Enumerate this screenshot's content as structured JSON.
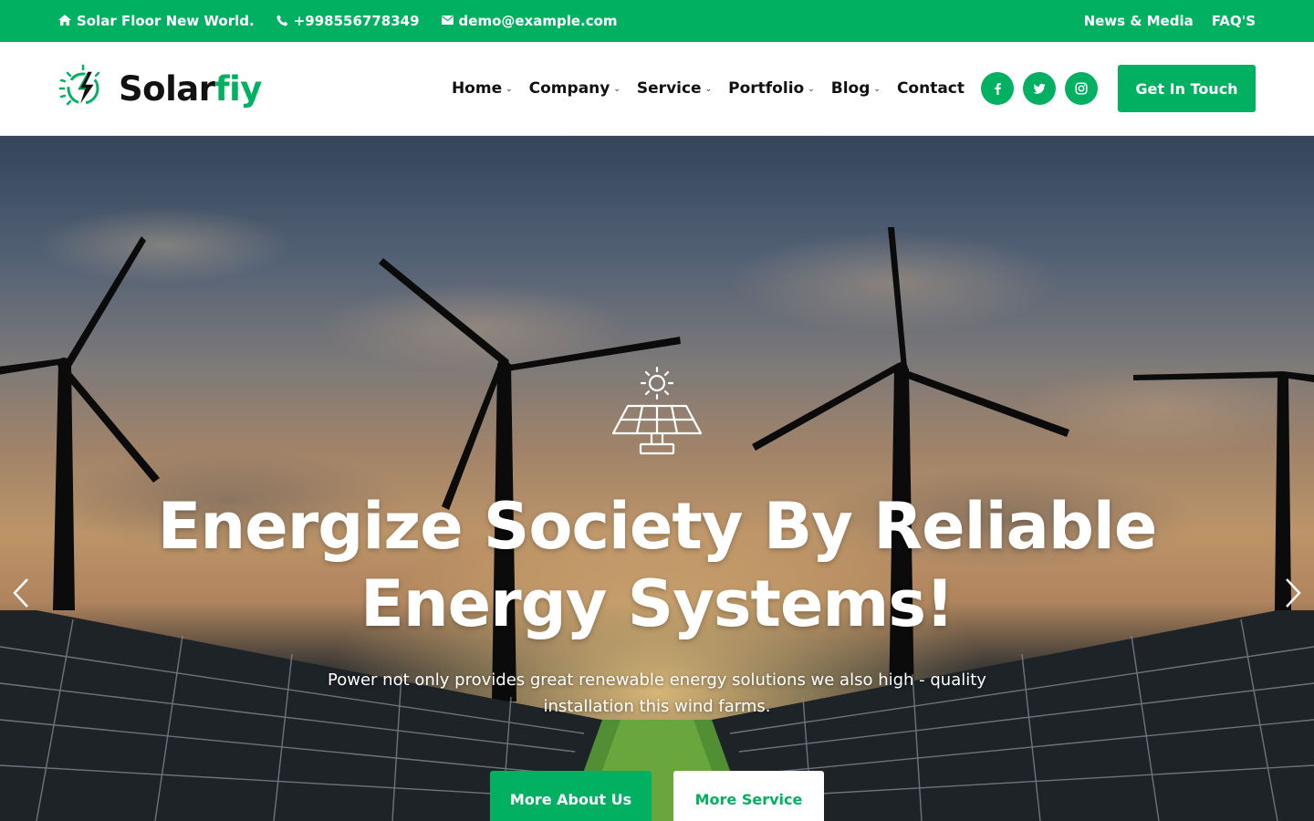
{
  "topbar": {
    "address": "Solar Floor New World.",
    "phone": "+998556778349",
    "email": "demo@example.com",
    "links": [
      "News & Media",
      "FAQ'S"
    ]
  },
  "header": {
    "logo": {
      "part1": "Solar",
      "part2": "fiy"
    },
    "nav": [
      {
        "label": "Home",
        "dropdown": true
      },
      {
        "label": "Company",
        "dropdown": true
      },
      {
        "label": "Service",
        "dropdown": true
      },
      {
        "label": "Portfolio",
        "dropdown": true
      },
      {
        "label": "Blog",
        "dropdown": true
      },
      {
        "label": "Contact",
        "dropdown": false
      }
    ],
    "socials": [
      "facebook-icon",
      "twitter-icon",
      "instagram-icon"
    ],
    "cta_label": "Get In Touch"
  },
  "hero": {
    "icon": "solar-panel-icon",
    "title": "Energize Society By Reliable Energy Systems!",
    "subtitle": "Power not only provides great renewable energy solutions we also high - quality installation this wind farms.",
    "primary_button": "More About Us",
    "secondary_button": "More Service"
  },
  "colors": {
    "accent": "#02b061"
  }
}
